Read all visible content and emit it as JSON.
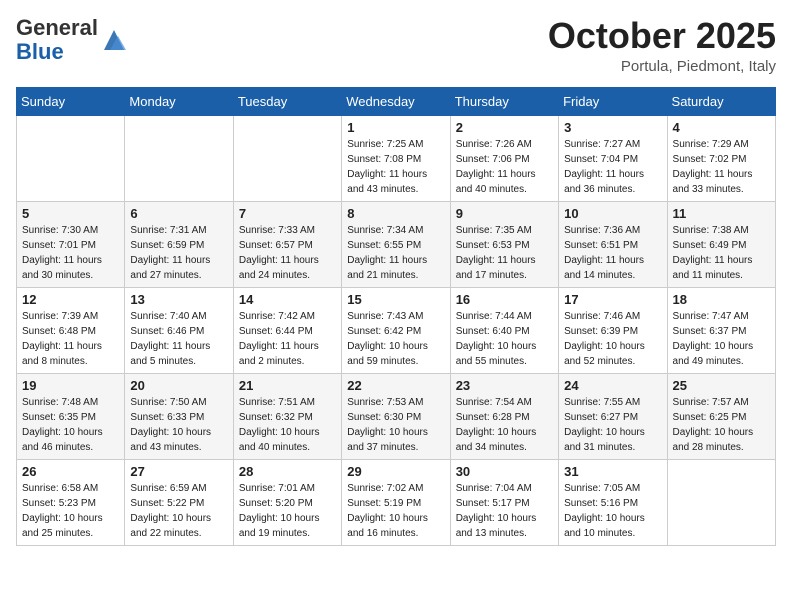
{
  "header": {
    "logo_general": "General",
    "logo_blue": "Blue",
    "month_title": "October 2025",
    "location": "Portula, Piedmont, Italy"
  },
  "days_of_week": [
    "Sunday",
    "Monday",
    "Tuesday",
    "Wednesday",
    "Thursday",
    "Friday",
    "Saturday"
  ],
  "weeks": [
    [
      {
        "day": "",
        "content": ""
      },
      {
        "day": "",
        "content": ""
      },
      {
        "day": "",
        "content": ""
      },
      {
        "day": "1",
        "content": "Sunrise: 7:25 AM\nSunset: 7:08 PM\nDaylight: 11 hours\nand 43 minutes."
      },
      {
        "day": "2",
        "content": "Sunrise: 7:26 AM\nSunset: 7:06 PM\nDaylight: 11 hours\nand 40 minutes."
      },
      {
        "day": "3",
        "content": "Sunrise: 7:27 AM\nSunset: 7:04 PM\nDaylight: 11 hours\nand 36 minutes."
      },
      {
        "day": "4",
        "content": "Sunrise: 7:29 AM\nSunset: 7:02 PM\nDaylight: 11 hours\nand 33 minutes."
      }
    ],
    [
      {
        "day": "5",
        "content": "Sunrise: 7:30 AM\nSunset: 7:01 PM\nDaylight: 11 hours\nand 30 minutes."
      },
      {
        "day": "6",
        "content": "Sunrise: 7:31 AM\nSunset: 6:59 PM\nDaylight: 11 hours\nand 27 minutes."
      },
      {
        "day": "7",
        "content": "Sunrise: 7:33 AM\nSunset: 6:57 PM\nDaylight: 11 hours\nand 24 minutes."
      },
      {
        "day": "8",
        "content": "Sunrise: 7:34 AM\nSunset: 6:55 PM\nDaylight: 11 hours\nand 21 minutes."
      },
      {
        "day": "9",
        "content": "Sunrise: 7:35 AM\nSunset: 6:53 PM\nDaylight: 11 hours\nand 17 minutes."
      },
      {
        "day": "10",
        "content": "Sunrise: 7:36 AM\nSunset: 6:51 PM\nDaylight: 11 hours\nand 14 minutes."
      },
      {
        "day": "11",
        "content": "Sunrise: 7:38 AM\nSunset: 6:49 PM\nDaylight: 11 hours\nand 11 minutes."
      }
    ],
    [
      {
        "day": "12",
        "content": "Sunrise: 7:39 AM\nSunset: 6:48 PM\nDaylight: 11 hours\nand 8 minutes."
      },
      {
        "day": "13",
        "content": "Sunrise: 7:40 AM\nSunset: 6:46 PM\nDaylight: 11 hours\nand 5 minutes."
      },
      {
        "day": "14",
        "content": "Sunrise: 7:42 AM\nSunset: 6:44 PM\nDaylight: 11 hours\nand 2 minutes."
      },
      {
        "day": "15",
        "content": "Sunrise: 7:43 AM\nSunset: 6:42 PM\nDaylight: 10 hours\nand 59 minutes."
      },
      {
        "day": "16",
        "content": "Sunrise: 7:44 AM\nSunset: 6:40 PM\nDaylight: 10 hours\nand 55 minutes."
      },
      {
        "day": "17",
        "content": "Sunrise: 7:46 AM\nSunset: 6:39 PM\nDaylight: 10 hours\nand 52 minutes."
      },
      {
        "day": "18",
        "content": "Sunrise: 7:47 AM\nSunset: 6:37 PM\nDaylight: 10 hours\nand 49 minutes."
      }
    ],
    [
      {
        "day": "19",
        "content": "Sunrise: 7:48 AM\nSunset: 6:35 PM\nDaylight: 10 hours\nand 46 minutes."
      },
      {
        "day": "20",
        "content": "Sunrise: 7:50 AM\nSunset: 6:33 PM\nDaylight: 10 hours\nand 43 minutes."
      },
      {
        "day": "21",
        "content": "Sunrise: 7:51 AM\nSunset: 6:32 PM\nDaylight: 10 hours\nand 40 minutes."
      },
      {
        "day": "22",
        "content": "Sunrise: 7:53 AM\nSunset: 6:30 PM\nDaylight: 10 hours\nand 37 minutes."
      },
      {
        "day": "23",
        "content": "Sunrise: 7:54 AM\nSunset: 6:28 PM\nDaylight: 10 hours\nand 34 minutes."
      },
      {
        "day": "24",
        "content": "Sunrise: 7:55 AM\nSunset: 6:27 PM\nDaylight: 10 hours\nand 31 minutes."
      },
      {
        "day": "25",
        "content": "Sunrise: 7:57 AM\nSunset: 6:25 PM\nDaylight: 10 hours\nand 28 minutes."
      }
    ],
    [
      {
        "day": "26",
        "content": "Sunrise: 6:58 AM\nSunset: 5:23 PM\nDaylight: 10 hours\nand 25 minutes."
      },
      {
        "day": "27",
        "content": "Sunrise: 6:59 AM\nSunset: 5:22 PM\nDaylight: 10 hours\nand 22 minutes."
      },
      {
        "day": "28",
        "content": "Sunrise: 7:01 AM\nSunset: 5:20 PM\nDaylight: 10 hours\nand 19 minutes."
      },
      {
        "day": "29",
        "content": "Sunrise: 7:02 AM\nSunset: 5:19 PM\nDaylight: 10 hours\nand 16 minutes."
      },
      {
        "day": "30",
        "content": "Sunrise: 7:04 AM\nSunset: 5:17 PM\nDaylight: 10 hours\nand 13 minutes."
      },
      {
        "day": "31",
        "content": "Sunrise: 7:05 AM\nSunset: 5:16 PM\nDaylight: 10 hours\nand 10 minutes."
      },
      {
        "day": "",
        "content": ""
      }
    ]
  ]
}
